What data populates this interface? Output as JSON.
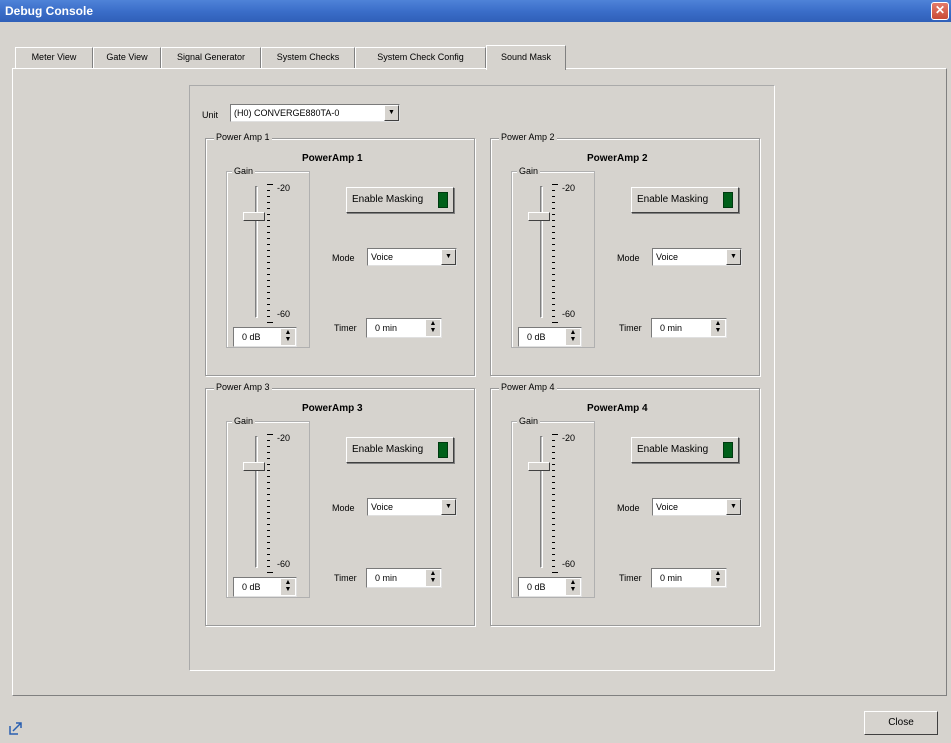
{
  "window": {
    "title": "Debug Console",
    "close_glyph": "✕"
  },
  "tabs": [
    {
      "label": "Meter View"
    },
    {
      "label": "Gate View"
    },
    {
      "label": "Signal Generator"
    },
    {
      "label": "System Checks"
    },
    {
      "label": "System Check Config"
    },
    {
      "label": "Sound Mask",
      "active": true
    }
  ],
  "unit": {
    "label": "Unit",
    "value": "(H0) CONVERGE880TA-0"
  },
  "amps": [
    {
      "group": "Power Amp 1",
      "title": "PowerAmp 1",
      "gain_label": "Gain",
      "scale_max": "-20",
      "scale_min": "-60",
      "gain_value": "0 dB",
      "gain_level": 0.15,
      "mask_label": "Enable Masking",
      "mode_label": "Mode",
      "mode_value": "Voice",
      "timer_label": "Timer",
      "timer_value": "0 min"
    },
    {
      "group": "Power Amp 2",
      "title": "PowerAmp 2",
      "gain_label": "Gain",
      "scale_max": "-20",
      "scale_min": "-60",
      "gain_value": "0 dB",
      "gain_level": 0.15,
      "mask_label": "Enable Masking",
      "mode_label": "Mode",
      "mode_value": "Voice",
      "timer_label": "Timer",
      "timer_value": "0 min"
    },
    {
      "group": "Power Amp 3",
      "title": "PowerAmp 3",
      "gain_label": "Gain",
      "scale_max": "-20",
      "scale_min": "-60",
      "gain_value": "0 dB",
      "gain_level": 0.15,
      "mask_label": "Enable Masking",
      "mode_label": "Mode",
      "mode_value": "Voice",
      "timer_label": "Timer",
      "timer_value": "0 min"
    },
    {
      "group": "Power Amp 4",
      "title": "PowerAmp 4",
      "gain_label": "Gain",
      "scale_max": "-20",
      "scale_min": "-60",
      "gain_value": "0 dB",
      "gain_level": 0.15,
      "mask_label": "Enable Masking",
      "mode_label": "Mode",
      "mode_value": "Voice",
      "timer_label": "Timer",
      "timer_value": "0 min"
    }
  ],
  "footer": {
    "close_label": "Close"
  },
  "colors": {
    "titlebar": "#3b6ec9",
    "window_bg": "#d6d3ce",
    "led_on": "#00601a"
  }
}
